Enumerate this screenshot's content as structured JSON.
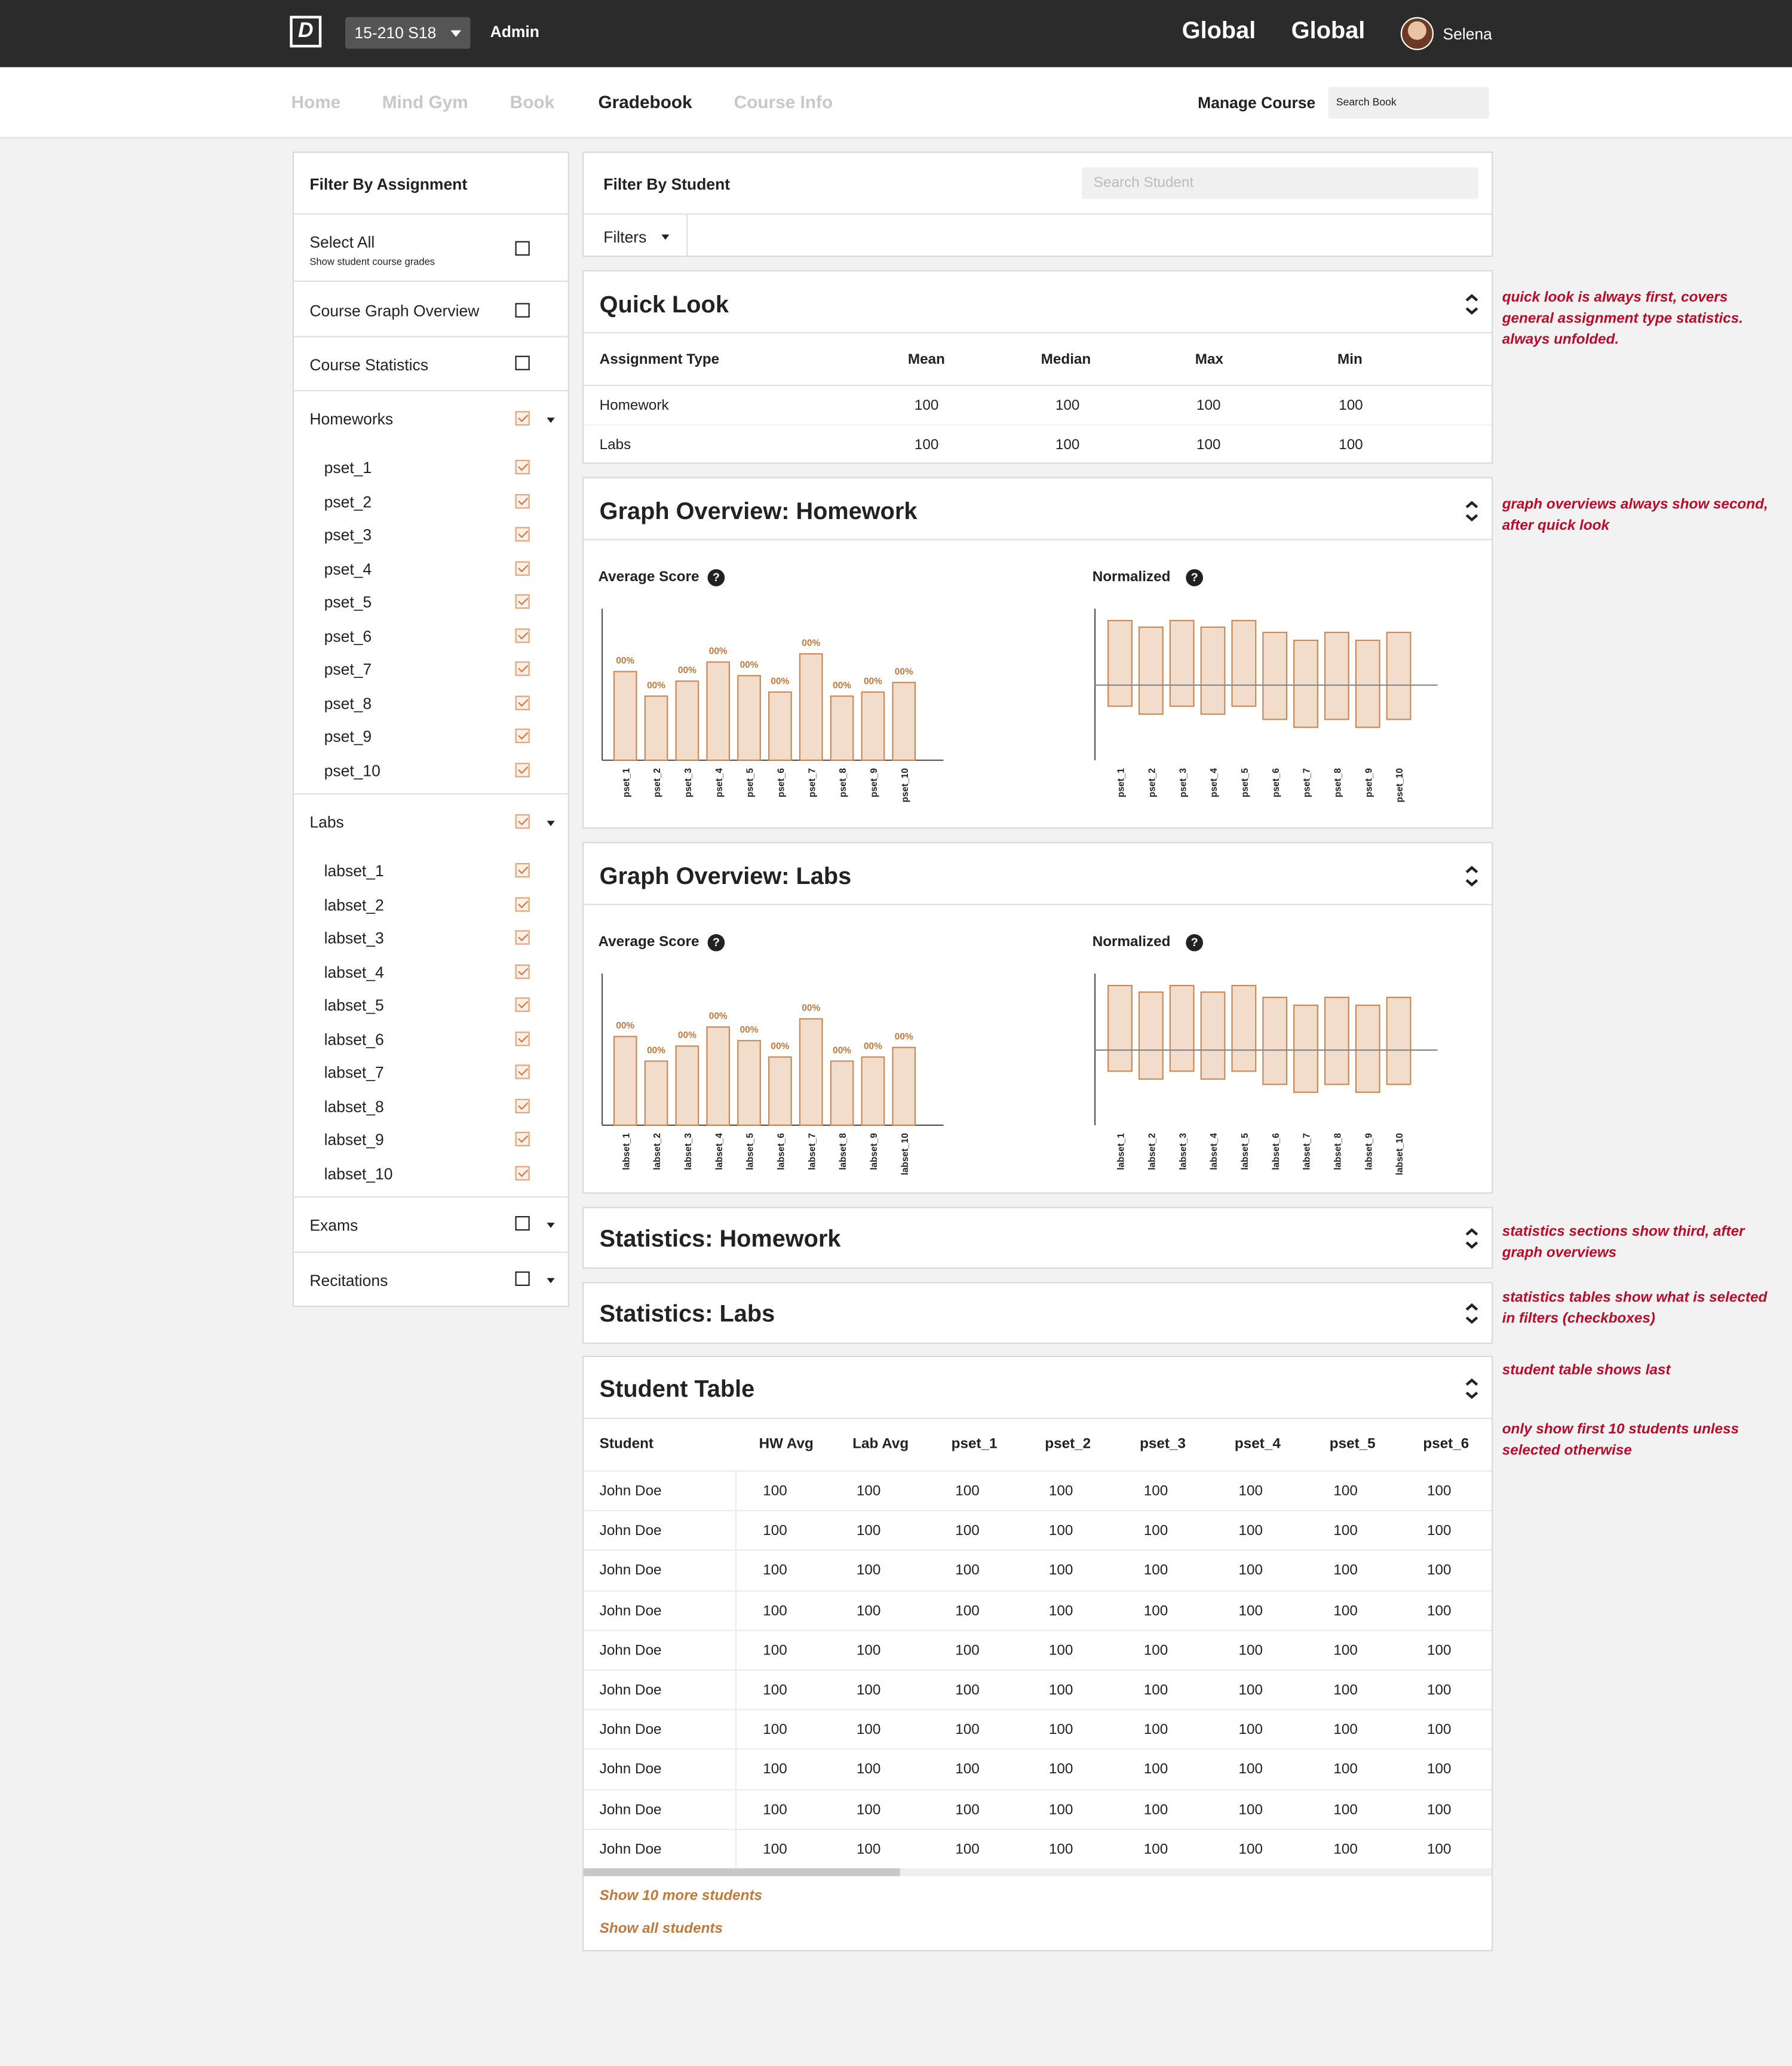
{
  "topbar": {
    "logo": "D",
    "course": "15-210  S18",
    "role": "Admin",
    "global_1": "Global",
    "global_2": "Global",
    "user": "Selena"
  },
  "nav": {
    "home": "Home",
    "mind_gym": "Mind Gym",
    "book": "Book",
    "gradebook": "Gradebook",
    "course_info": "Course Info",
    "manage": "Manage Course",
    "search_placeholder": "Search Book"
  },
  "sidebar": {
    "title": "Filter By Assignment",
    "select_all": "Select All",
    "select_all_sub": "Show student course grades",
    "course_graph": "Course Graph Overview",
    "course_stats": "Course Statistics",
    "homeworks": "Homeworks",
    "homework_items": [
      "pset_1",
      "pset_2",
      "pset_3",
      "pset_4",
      "pset_5",
      "pset_6",
      "pset_7",
      "pset_8",
      "pset_9",
      "pset_10"
    ],
    "labs": "Labs",
    "lab_items": [
      "labset_1",
      "labset_2",
      "labset_3",
      "labset_4",
      "labset_5",
      "labset_6",
      "labset_7",
      "labset_8",
      "labset_9",
      "labset_10"
    ],
    "exams": "Exams",
    "recitations": "Recitations"
  },
  "filter_student": {
    "title": "Filter By Student",
    "search_placeholder": "Search Student",
    "filters": "Filters"
  },
  "quick_look": {
    "title": "Quick Look",
    "headers": [
      "Assignment Type",
      "Mean",
      "Median",
      "Max",
      "Min"
    ],
    "rows": [
      [
        "Homework",
        "100",
        "100",
        "100",
        "100"
      ],
      [
        "Labs",
        "100",
        "100",
        "100",
        "100"
      ]
    ]
  },
  "graph_hw": {
    "title": "Graph Overview: Homework",
    "avg_label": "Average Score",
    "norm_label": "Normalized"
  },
  "graph_labs": {
    "title": "Graph Overview: Labs",
    "avg_label": "Average Score",
    "norm_label": "Normalized"
  },
  "stats_hw": {
    "title": "Statistics: Homework"
  },
  "stats_labs": {
    "title": "Statistics: Labs"
  },
  "student_table": {
    "title": "Student Table",
    "headers": [
      "Student",
      "HW Avg",
      "Lab Avg",
      "pset_1",
      "pset_2",
      "pset_3",
      "pset_4",
      "pset_5",
      "pset_6"
    ],
    "rows": [
      [
        "John Doe",
        "100",
        "100",
        "100",
        "100",
        "100",
        "100",
        "100",
        "100"
      ],
      [
        "John Doe",
        "100",
        "100",
        "100",
        "100",
        "100",
        "100",
        "100",
        "100"
      ],
      [
        "John Doe",
        "100",
        "100",
        "100",
        "100",
        "100",
        "100",
        "100",
        "100"
      ],
      [
        "John Doe",
        "100",
        "100",
        "100",
        "100",
        "100",
        "100",
        "100",
        "100"
      ],
      [
        "John Doe",
        "100",
        "100",
        "100",
        "100",
        "100",
        "100",
        "100",
        "100"
      ],
      [
        "John Doe",
        "100",
        "100",
        "100",
        "100",
        "100",
        "100",
        "100",
        "100"
      ],
      [
        "John Doe",
        "100",
        "100",
        "100",
        "100",
        "100",
        "100",
        "100",
        "100"
      ],
      [
        "John Doe",
        "100",
        "100",
        "100",
        "100",
        "100",
        "100",
        "100",
        "100"
      ],
      [
        "John Doe",
        "100",
        "100",
        "100",
        "100",
        "100",
        "100",
        "100",
        "100"
      ],
      [
        "John Doe",
        "100",
        "100",
        "100",
        "100",
        "100",
        "100",
        "100",
        "100"
      ]
    ],
    "show_more": "Show 10 more students",
    "show_all": "Show all students"
  },
  "notes": {
    "n1": "quick look is always first, covers general assignment type statistics. always unfolded.",
    "n2": "graph overviews always  show second, after quick look",
    "n3": "statistics sections show third, after graph overviews",
    "n4": "statistics tables show what is selected in filters (checkboxes)",
    "n5": "student table shows last",
    "n6": "only show first 10 students unless selected otherwise"
  },
  "colors": {
    "bar_fill": "#f2dccb",
    "bar_stroke": "#c98a58",
    "label": "#c1793b",
    "note": "#b80c2a"
  },
  "chart_data": [
    {
      "type": "bar",
      "title": "Average Score",
      "categories": [
        "pset_1",
        "pset_2",
        "pset_3",
        "pset_4",
        "pset_5",
        "pset_6",
        "pset_7",
        "pset_8",
        "pset_9",
        "pset_10"
      ],
      "values": [
        65,
        47,
        58,
        72,
        62,
        50,
        78,
        47,
        50,
        57
      ],
      "data_labels": [
        "00%",
        "00%",
        "00%",
        "00%",
        "00%",
        "00%",
        "00%",
        "00%",
        "00%",
        "00%"
      ],
      "ylim": [
        0,
        100
      ]
    },
    {
      "type": "bar",
      "title": "Normalized",
      "categories": [
        "pset_1",
        "pset_2",
        "pset_3",
        "pset_4",
        "pset_5",
        "pset_6",
        "pset_7",
        "pset_8",
        "pset_9",
        "pset_10"
      ],
      "ranges": [
        [
          -16,
          49
        ],
        [
          -22,
          44
        ],
        [
          -16,
          49
        ],
        [
          -22,
          44
        ],
        [
          -16,
          49
        ],
        [
          -26,
          40
        ],
        [
          -32,
          34
        ],
        [
          -26,
          40
        ],
        [
          -32,
          34
        ],
        [
          -26,
          40
        ]
      ]
    },
    {
      "type": "bar",
      "title": "Average Score",
      "categories": [
        "labset_1",
        "labset_2",
        "labset_3",
        "labset_4",
        "labset_5",
        "labset_6",
        "labset_7",
        "labset_8",
        "labset_9",
        "labset_10"
      ],
      "values": [
        65,
        47,
        58,
        72,
        62,
        50,
        78,
        47,
        50,
        57
      ],
      "data_labels": [
        "00%",
        "00%",
        "00%",
        "00%",
        "00%",
        "00%",
        "00%",
        "00%",
        "00%",
        "00%"
      ],
      "ylim": [
        0,
        100
      ]
    },
    {
      "type": "bar",
      "title": "Normalized",
      "categories": [
        "labset_1",
        "labset_2",
        "labset_3",
        "labset_4",
        "labset_5",
        "labset_6",
        "labset_7",
        "labset_8",
        "labset_9",
        "labset_10"
      ],
      "ranges": [
        [
          -16,
          49
        ],
        [
          -22,
          44
        ],
        [
          -16,
          49
        ],
        [
          -22,
          44
        ],
        [
          -16,
          49
        ],
        [
          -26,
          40
        ],
        [
          -32,
          34
        ],
        [
          -26,
          40
        ],
        [
          -32,
          34
        ],
        [
          -26,
          40
        ]
      ]
    }
  ]
}
